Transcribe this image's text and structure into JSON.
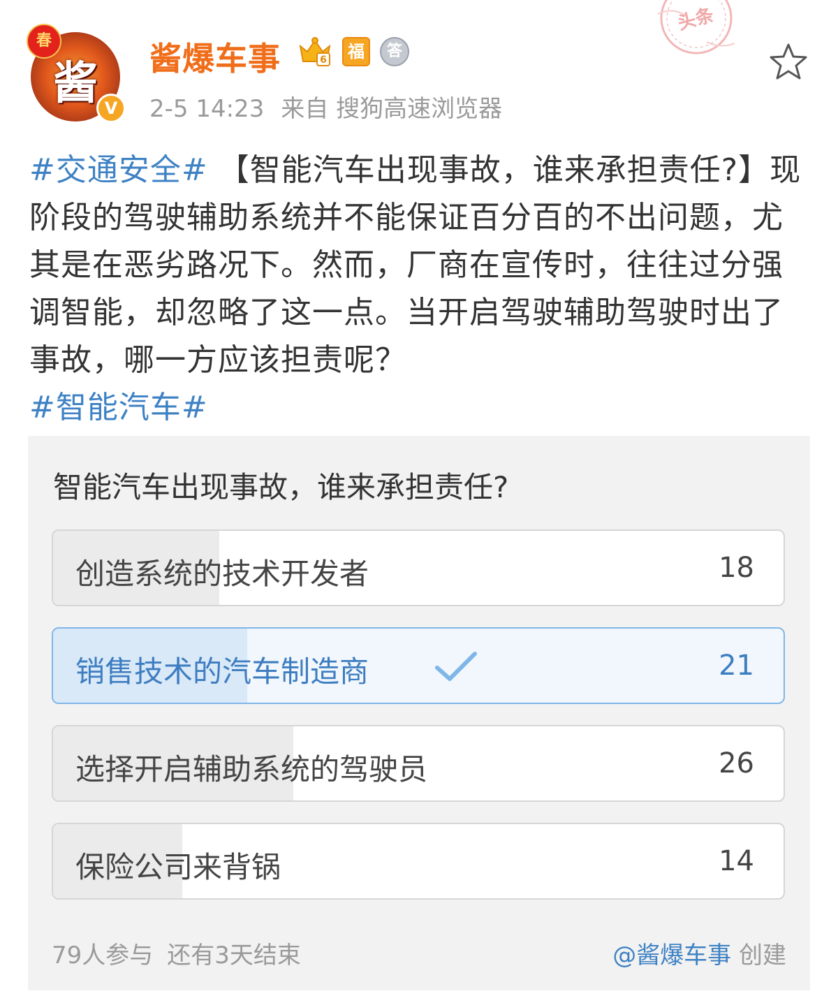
{
  "user": {
    "avatar_char": "酱",
    "spring_char": "春",
    "verified_mark": "V",
    "name": "酱爆车事",
    "badges": [
      {
        "icon": "crown-level-icon",
        "text": "6"
      },
      {
        "icon": "fu-badge-icon",
        "text": "福"
      },
      {
        "icon": "answer-medal-icon",
        "text": "答"
      }
    ]
  },
  "post": {
    "time": "2-5 14:23",
    "source": "来自 搜狗高速浏览器",
    "stamp_text": "头条",
    "hashtag_1": "#交通安全#",
    "body": " 【智能汽车出现事故，谁来承担责任?】现阶段的驾驶辅助系统并不能保证百分百的不出问题，尤其是在恶劣路况下。然而，厂商在宣传时，往往过分强调智能，却忽略了这一点。当开启驾驶辅助驾驶时出了事故，哪一方应该担责呢？",
    "hashtag_2": "#智能汽车#"
  },
  "poll": {
    "question": "智能汽车出现事故，谁来承担责任?",
    "options": [
      {
        "label": "创造系统的技术开发者",
        "count": "18",
        "share": 0.228,
        "selected": false
      },
      {
        "label": "销售技术的汽车制造商",
        "count": "21",
        "share": 0.266,
        "selected": true
      },
      {
        "label": "选择开启辅助系统的驾驶员",
        "count": "26",
        "share": 0.329,
        "selected": false
      },
      {
        "label": "保险公司来背锅",
        "count": "14",
        "share": 0.177,
        "selected": false
      }
    ],
    "participants": "79人参与",
    "remaining": "还有3天结束",
    "creator_mention": "@酱爆车事",
    "creator_suffix": " 创建"
  },
  "colors": {
    "username": "#f06d1a",
    "hashtag": "#3e82c4",
    "selected": "#3e7dc0"
  }
}
